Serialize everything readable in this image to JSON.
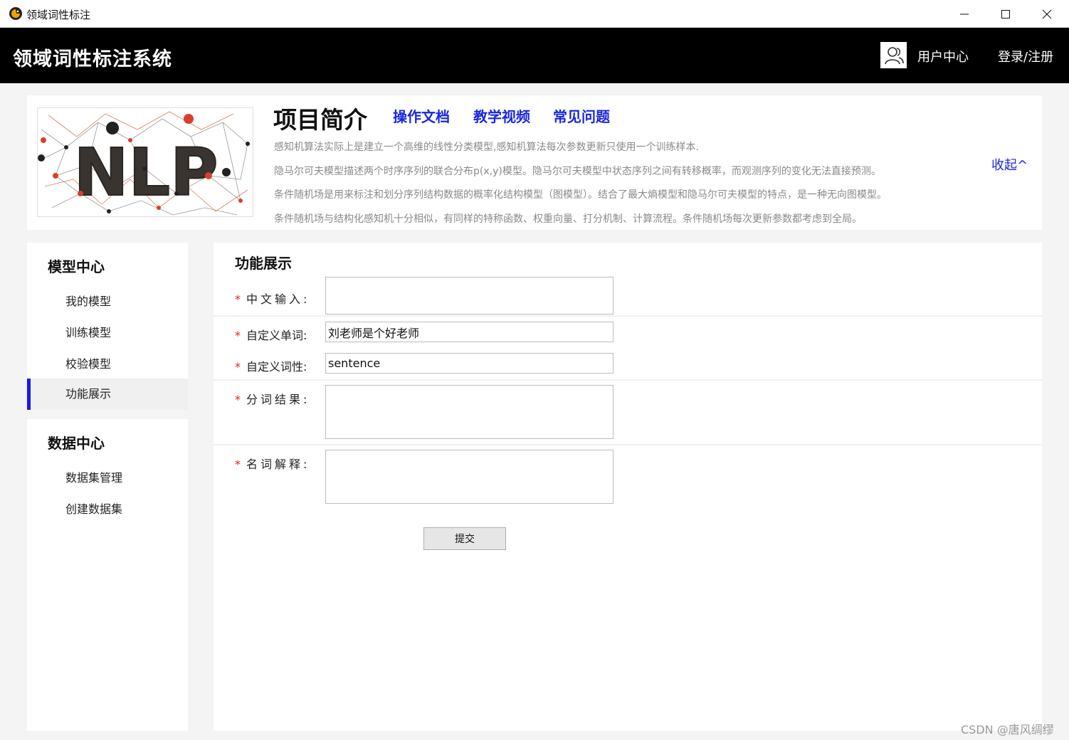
{
  "window": {
    "title": "领域词性标注"
  },
  "header": {
    "brand": "领域词性标注系统",
    "user_center": "用户中心",
    "login": "登录/注册"
  },
  "intro": {
    "image_text": "NLP",
    "title": "项目简介",
    "links": [
      "操作文档",
      "教学视频",
      "常见问题"
    ],
    "lines": [
      "感知机算法实际上是建立一个高维的线性分类模型,感知机算法每次参数更新只使用一个训练样本.",
      "隐马尔可夫模型描述两个时序序列的联合分布p(x,y)模型。隐马尔可夫模型中状态序列之间有转移概率，而观测序列的变化无法直接预测。",
      "条件随机场是用来标注和划分序列结构数据的概率化结构模型（图模型）。结合了最大熵模型和隐马尔可夫模型的特点，是一种无向图模型。",
      "条件随机场与结构化感知机十分相似，有同样的特称函数、权重向量、打分机制、计算流程。条件随机场每次更新参数都考虑到全局。"
    ],
    "collapse": "收起^"
  },
  "sidebar": {
    "model_center": {
      "title": "模型中心",
      "items": [
        "我的模型",
        "训练模型",
        "校验模型",
        "功能展示"
      ],
      "active": "功能展示"
    },
    "data_center": {
      "title": "数据中心",
      "items": [
        "数据集管理",
        "创建数据集"
      ]
    }
  },
  "main": {
    "title": "功能展示",
    "required_mark": "*",
    "fields": {
      "chinese_input": {
        "label": "中文输入:",
        "value": ""
      },
      "custom_word": {
        "label": "自定义单词:",
        "value": "刘老师是个好老师"
      },
      "custom_pos": {
        "label": "自定义词性:",
        "value": "sentence"
      },
      "segment_result": {
        "label": "分词结果:",
        "value": ""
      },
      "term_explain": {
        "label": "名词解释:",
        "value": ""
      }
    },
    "submit": "提交"
  },
  "watermark": "CSDN @唐风绸缪",
  "colors": {
    "accent": "#1a27e0",
    "header_bg": "#000000",
    "required": "#e02020"
  }
}
